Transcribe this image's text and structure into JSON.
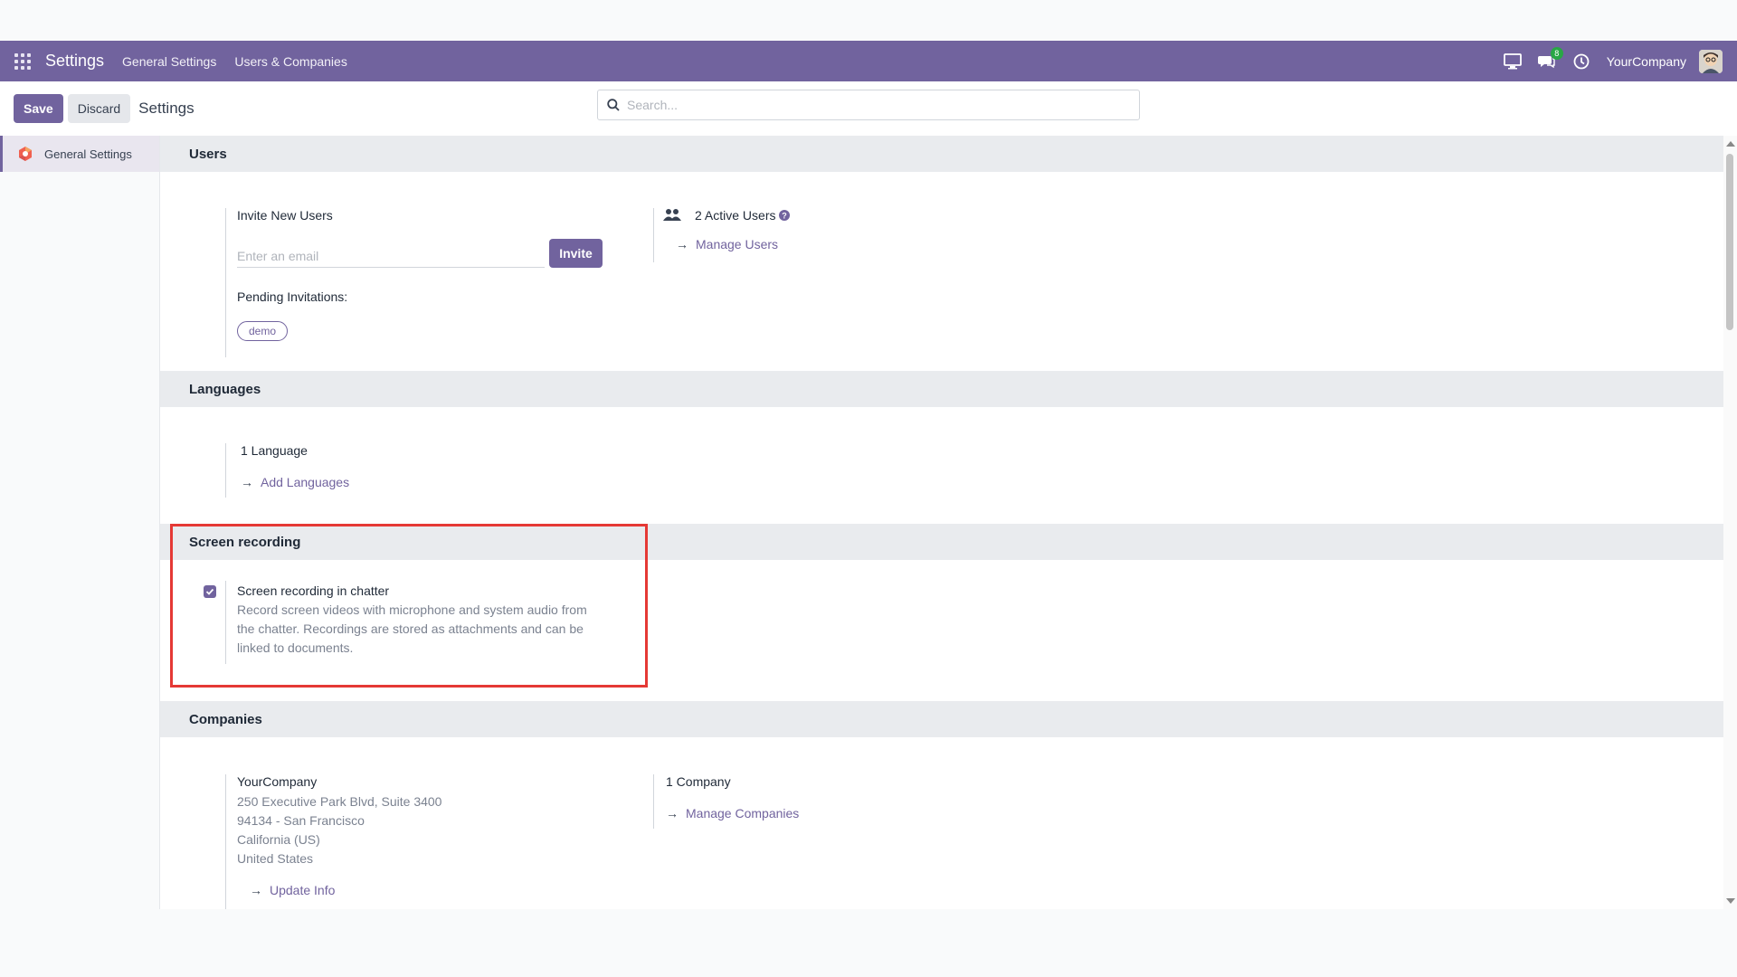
{
  "navbar": {
    "app_name": "Settings",
    "menu": [
      "General Settings",
      "Users & Companies"
    ],
    "chat_badge": "8",
    "company": "YourCompany"
  },
  "control": {
    "save_label": "Save",
    "discard_label": "Discard",
    "breadcrumb": "Settings",
    "search_placeholder": "Search..."
  },
  "sidebar": {
    "items": [
      {
        "label": "General Settings"
      }
    ]
  },
  "users": {
    "title": "Users",
    "invite_title": "Invite New Users",
    "email_placeholder": "Enter an email",
    "invite_label": "Invite",
    "pending_label": "Pending Invitations:",
    "pending": [
      "demo"
    ],
    "active_users": "2 Active Users",
    "manage_users": "Manage Users"
  },
  "languages": {
    "title": "Languages",
    "count": "1 Language",
    "add": "Add Languages"
  },
  "screen_recording": {
    "title": "Screen recording",
    "setting_title": "Screen recording in chatter",
    "checked": true,
    "description_lines": [
      "Record screen videos with microphone and system audio from",
      "the chatter. Recordings are stored as attachments and can be",
      "linked to documents."
    ]
  },
  "companies": {
    "title": "Companies",
    "company_name": "YourCompany",
    "address_lines": [
      "250 Executive Park Blvd, Suite 3400",
      "94134 - San Francisco",
      "California (US)",
      "United States"
    ],
    "update_info": "Update Info",
    "count": "1 Company",
    "manage": "Manage Companies"
  },
  "colors": {
    "brand": "#71639e",
    "highlight": "#e53935"
  }
}
